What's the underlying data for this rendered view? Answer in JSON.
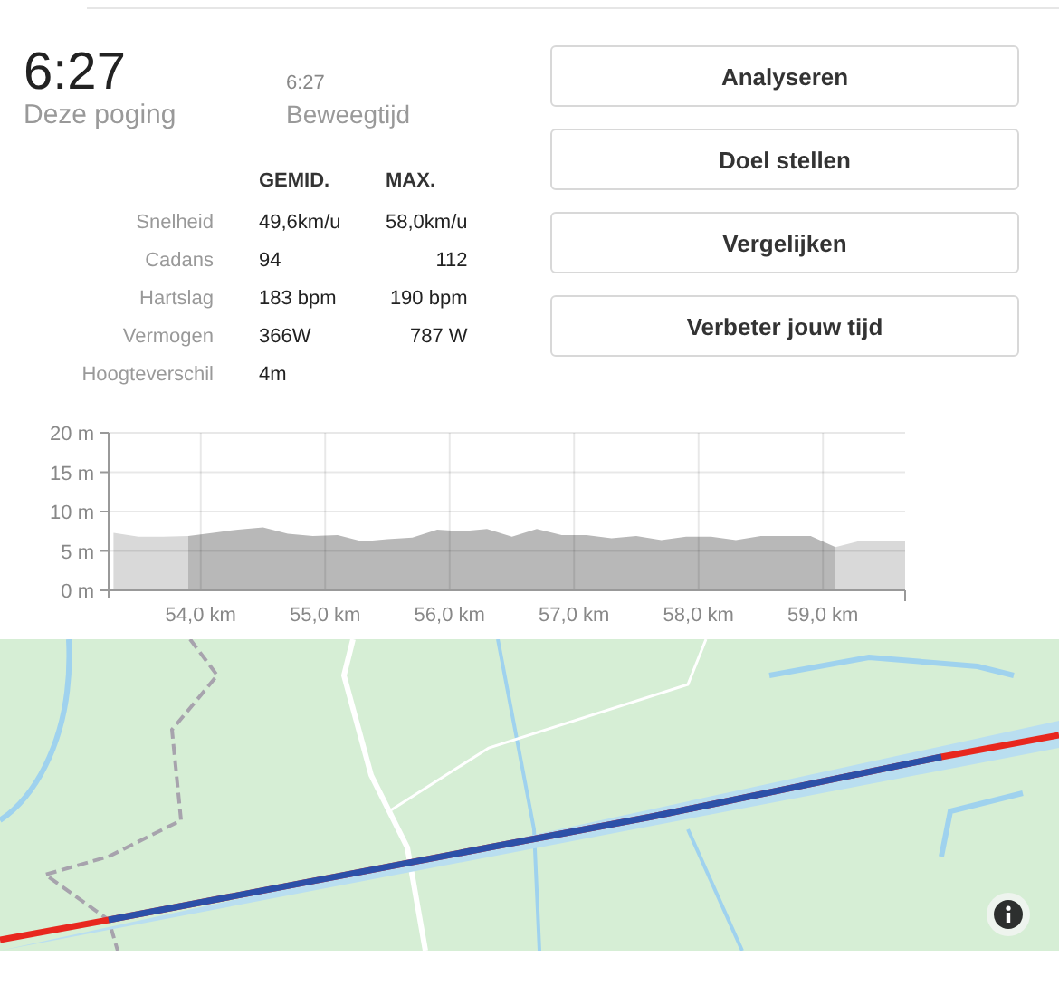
{
  "summary": [
    {
      "value": "6:27",
      "label": "Deze poging",
      "kind": "primary"
    },
    {
      "value": "6:27",
      "label": "Beweegtijd",
      "kind": "secondary"
    }
  ],
  "stats": {
    "columns": [
      "GEMID.",
      "MAX."
    ],
    "rows": [
      {
        "label": "Snelheid",
        "avg": "49,6km/u",
        "max": "58,0km/u"
      },
      {
        "label": "Cadans",
        "avg": "94",
        "max": "112"
      },
      {
        "label": "Hartslag",
        "avg": "183 bpm",
        "max": "190 bpm"
      },
      {
        "label": "Vermogen",
        "avg": "366W",
        "max": "787 W"
      },
      {
        "label": "Hoogteverschil",
        "avg": "4m"
      }
    ]
  },
  "buttons": [
    "Analyseren",
    "Doel stellen",
    "Vergelijken",
    "Verbeter jouw tijd"
  ],
  "elevation": {
    "chart_data": {
      "type": "area",
      "x": [
        53.3,
        53.5,
        53.7,
        53.9,
        54.1,
        54.3,
        54.5,
        54.7,
        54.9,
        55.1,
        55.3,
        55.5,
        55.7,
        55.9,
        56.1,
        56.3,
        56.5,
        56.7,
        56.9,
        57.1,
        57.3,
        57.5,
        57.7,
        57.9,
        58.1,
        58.3,
        58.5,
        58.7,
        58.9,
        59.1,
        59.3,
        59.5,
        59.66
      ],
      "series": [
        {
          "color": "#d9d9d9",
          "values": [
            7.3,
            6.8,
            6.8,
            6.9,
            null,
            null,
            null,
            null,
            null,
            null,
            null,
            null,
            null,
            null,
            null,
            null,
            null,
            null,
            null,
            null,
            null,
            null,
            null,
            null,
            null,
            null,
            null,
            null,
            null,
            5.5,
            6.3,
            6.2,
            6.2
          ]
        },
        {
          "color": "#b8b8b8",
          "values": [
            null,
            null,
            null,
            6.9,
            7.3,
            7.7,
            8.0,
            7.2,
            6.9,
            7.0,
            6.2,
            6.5,
            6.7,
            7.7,
            7.5,
            7.8,
            6.8,
            7.8,
            7.0,
            7.0,
            6.6,
            6.9,
            6.4,
            6.8,
            6.8,
            6.4,
            6.9,
            6.9,
            6.9,
            5.5,
            null,
            null,
            null
          ]
        }
      ],
      "xlim": [
        53.26,
        59.66
      ],
      "grid": true,
      "ylim": [
        0,
        20
      ],
      "xticks": [
        {
          "value": 54,
          "label": "54,0 km"
        },
        {
          "value": 55,
          "label": "55,0 km"
        },
        {
          "value": 56,
          "label": "56,0 km"
        },
        {
          "value": 57,
          "label": "57,0 km"
        },
        {
          "value": 58,
          "label": "58,0 km"
        },
        {
          "value": 59,
          "label": "59,0 km"
        }
      ],
      "yticks": [
        {
          "value": 0,
          "label": "0 m"
        },
        {
          "value": 5,
          "label": "5 m"
        },
        {
          "value": 10,
          "label": "10 m"
        },
        {
          "value": 15,
          "label": "15 m"
        },
        {
          "value": 20,
          "label": "20 m"
        }
      ]
    }
  },
  "map": {
    "kind": "picture"
  }
}
